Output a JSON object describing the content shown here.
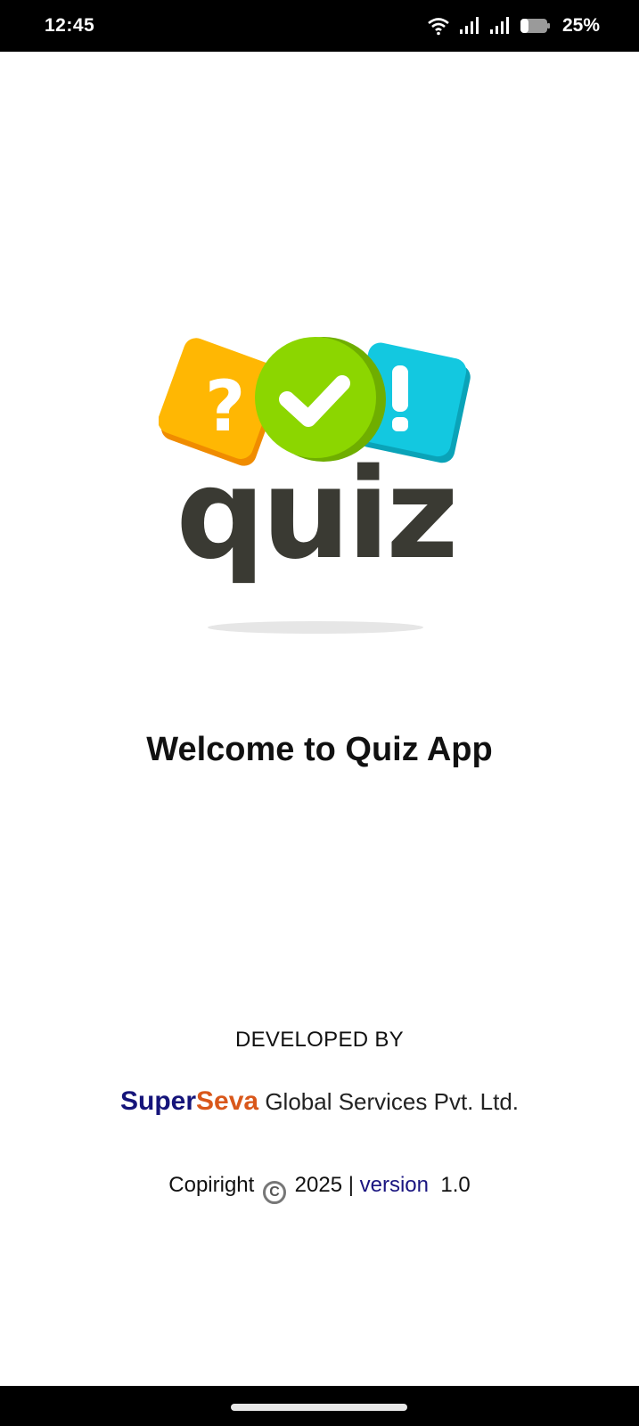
{
  "status_bar": {
    "time": "12:45",
    "battery_percent": "25%",
    "battery_level": 0.25,
    "icons": [
      "wifi-icon",
      "signal-icon",
      "signal-icon",
      "battery-icon"
    ]
  },
  "logo": {
    "wordmark": "quiz",
    "colors": {
      "orange": "#FFB703",
      "green": "#8CD600",
      "cyan": "#13C8E0",
      "text": "#3A3A33"
    }
  },
  "welcome": {
    "title": "Welcome to Quiz App"
  },
  "footer": {
    "developed_by": "DEVELOPED BY",
    "brand_super": "Super",
    "brand_seva": "Seva",
    "company_rest": " Global Services Pvt. Ltd.",
    "copyright_label": "Copiright",
    "copyright_symbol": "C",
    "year": "2025 |",
    "version_label": "version",
    "version_number": "1.0"
  },
  "colors": {
    "brand_super": "#15147a",
    "brand_seva": "#d9571a",
    "version_label": "#1a1580"
  }
}
